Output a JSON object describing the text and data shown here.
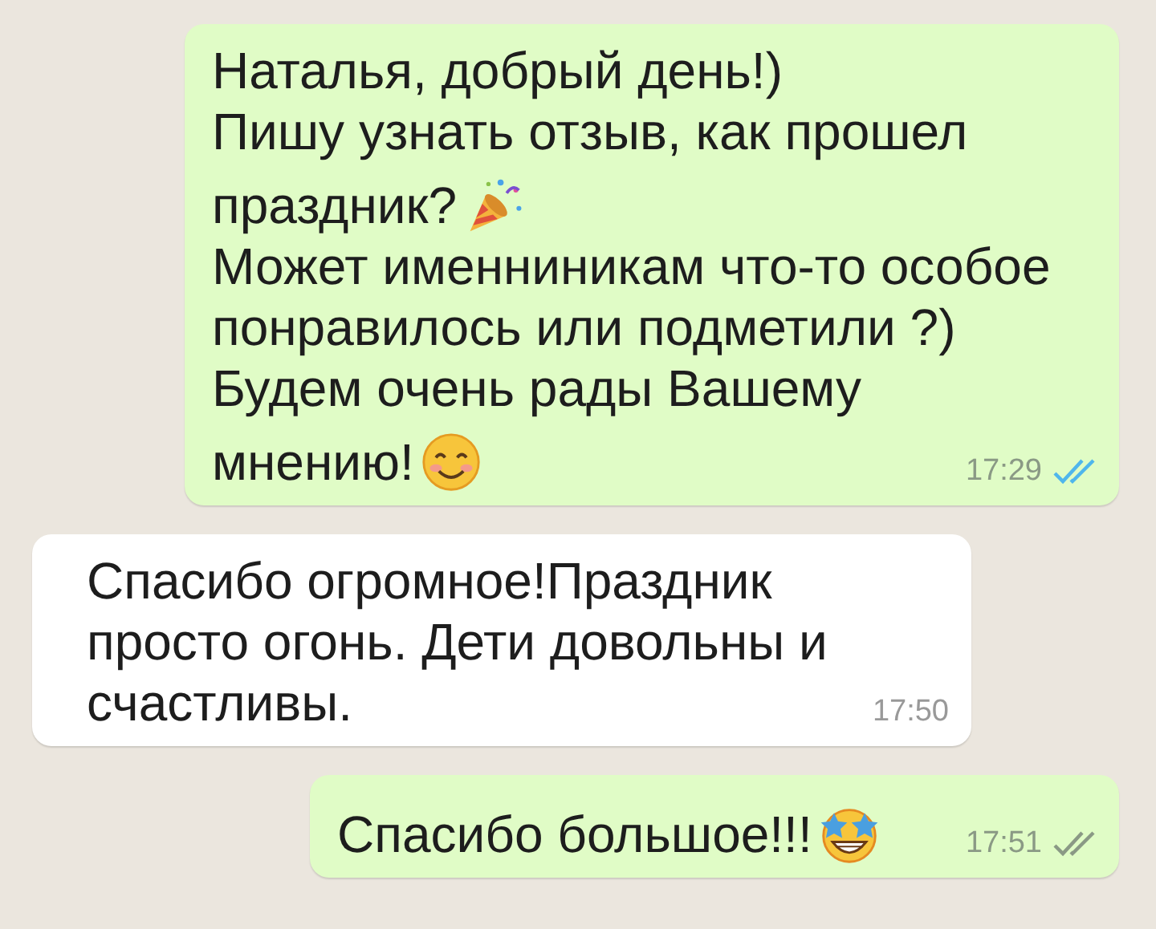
{
  "messages": [
    {
      "outgoing": true,
      "lines": [
        {
          "text": "Наталья, добрый день!)"
        },
        {
          "text": "Пишу узнать отзыв, как прошел"
        },
        {
          "text": "праздник?",
          "icon": {
            "kind": "popper"
          }
        },
        {
          "text": "Может именниникам что-то особое"
        },
        {
          "text": "понравилось или подметили ?)"
        },
        {
          "text": "Будем очень рады Вашему"
        },
        {
          "text": "мнению!",
          "icon": {
            "kind": "smile"
          }
        }
      ],
      "time": "17:29",
      "read": true
    },
    {
      "outgoing": false,
      "lines": [
        {
          "text": "Спасибо огромное!Праздник"
        },
        {
          "text": "просто огонь. Дети довольны и"
        },
        {
          "text": "счастливы."
        }
      ],
      "time": "17:50"
    },
    {
      "outgoing": true,
      "lines": [
        {
          "text": "Спасибо большое!!!",
          "icon": {
            "kind": "stars"
          }
        }
      ],
      "time": "17:51",
      "read": false
    }
  ]
}
